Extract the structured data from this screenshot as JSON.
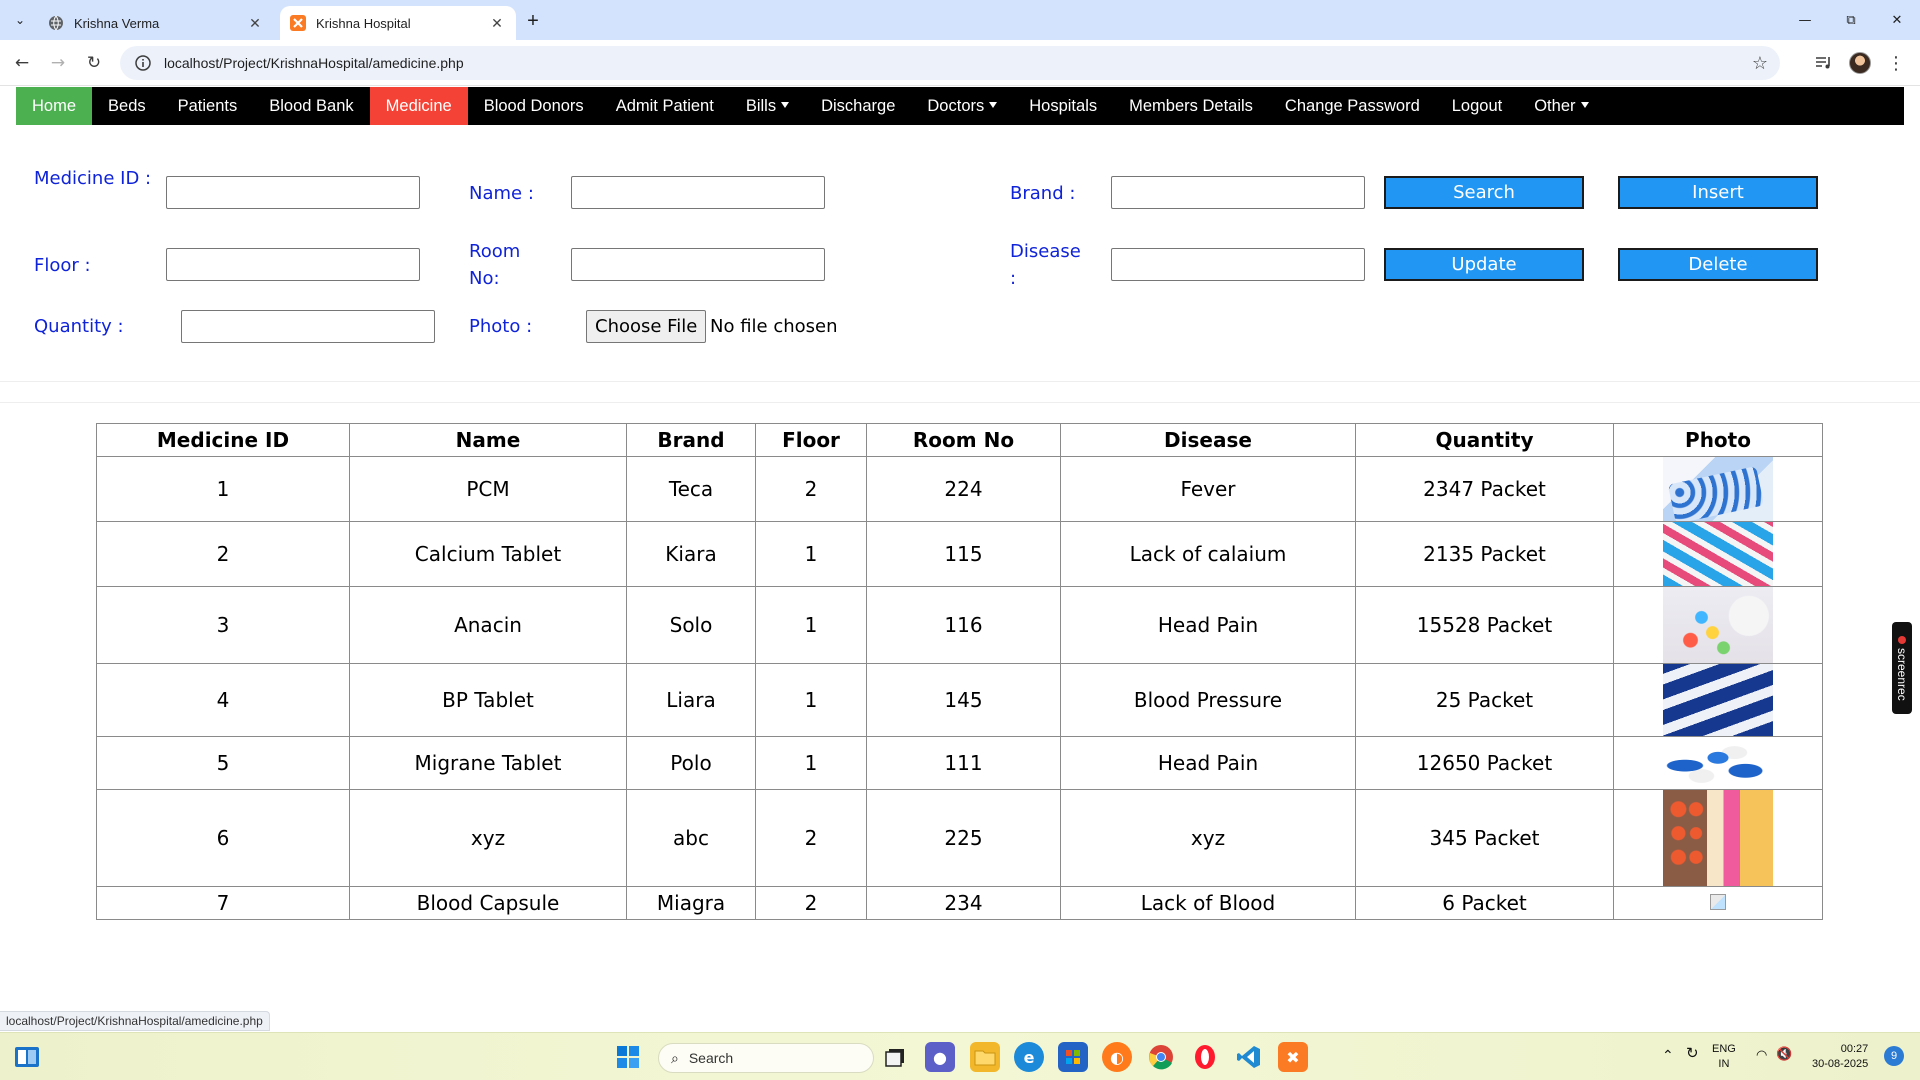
{
  "browser": {
    "tabs": [
      {
        "title": "Krishna Verma",
        "active": false
      },
      {
        "title": "Krishna Hospital",
        "active": true
      }
    ],
    "url": "localhost/Project/KrishnaHospital/amedicine.php",
    "status_url": "localhost/Project/KrishnaHospital/amedicine.php"
  },
  "navbar": {
    "items": [
      {
        "label": "Home"
      },
      {
        "label": "Beds"
      },
      {
        "label": "Patients"
      },
      {
        "label": "Blood Bank"
      },
      {
        "label": "Medicine"
      },
      {
        "label": "Blood Donors"
      },
      {
        "label": "Admit Patient"
      },
      {
        "label": "Bills"
      },
      {
        "label": "Discharge"
      },
      {
        "label": "Doctors"
      },
      {
        "label": "Hospitals"
      },
      {
        "label": "Members Details"
      },
      {
        "label": "Change Password"
      },
      {
        "label": "Logout"
      },
      {
        "label": "Other"
      }
    ],
    "active": "Medicine",
    "colors": {
      "home": "#4caf50",
      "active": "#f44336",
      "bar": "#000000"
    }
  },
  "form": {
    "medicine_id_label": "Medicine ID :",
    "name_label": "Name :",
    "brand_label": "Brand :",
    "floor_label": "Floor :",
    "room_label": "Room No:",
    "disease_label": "Disease :",
    "quantity_label": "Quantity :",
    "photo_label": "Photo :",
    "file_button": "Choose File",
    "file_status": "No file chosen",
    "medicine_id_value": "",
    "name_value": "",
    "brand_value": "",
    "floor_value": "",
    "room_value": "",
    "disease_value": "",
    "quantity_value": "",
    "buttons": {
      "search": "Search",
      "insert": "Insert",
      "update": "Update",
      "delete": "Delete"
    },
    "colors": {
      "label": "#0f23d8",
      "button": "#2196f3"
    }
  },
  "table": {
    "headers": [
      "Medicine ID",
      "Name",
      "Brand",
      "Floor",
      "Room No",
      "Disease",
      "Quantity",
      "Photo"
    ],
    "rows": [
      {
        "id": "1",
        "name": "PCM",
        "brand": "Teca",
        "floor": "2",
        "room": "224",
        "disease": "Fever",
        "quantity": "2347 Packet",
        "photo": "blister-pack-photo"
      },
      {
        "id": "2",
        "name": "Calcium Tablet",
        "brand": "Kiara",
        "floor": "1",
        "room": "115",
        "disease": "Lack of calaium",
        "quantity": "2135 Packet",
        "photo": "capsule-blister-photo"
      },
      {
        "id": "3",
        "name": "Anacin",
        "brand": "Solo",
        "floor": "1",
        "room": "116",
        "disease": "Head Pain",
        "quantity": "15528 Packet",
        "photo": "pill-bottle-photo"
      },
      {
        "id": "4",
        "name": "BP Tablet",
        "brand": "Liara",
        "floor": "1",
        "room": "145",
        "disease": "Blood Pressure",
        "quantity": "25 Packet",
        "photo": "blue-capsules-photo"
      },
      {
        "id": "5",
        "name": "Migrane Tablet",
        "brand": "Polo",
        "floor": "1",
        "room": "111",
        "disease": "Head Pain",
        "quantity": "12650 Packet",
        "photo": "blue-white-capsules-photo"
      },
      {
        "id": "6",
        "name": "xyz",
        "brand": "abc",
        "floor": "2",
        "room": "225",
        "disease": "xyz",
        "quantity": "345 Packet",
        "photo": "mixed-blister-photo"
      },
      {
        "id": "7",
        "name": "Blood Capsule",
        "brand": "Miagra",
        "floor": "2",
        "room": "234",
        "disease": "Lack of Blood",
        "quantity": "6 Packet",
        "photo": "broken-image-icon"
      }
    ]
  },
  "screenrec": {
    "label": "screenrec"
  },
  "taskbar": {
    "search_placeholder": "Search",
    "lang_top": "ENG",
    "lang_bottom": "IN",
    "time": "00:27",
    "date": "30-08-2025",
    "notifications": "9"
  }
}
